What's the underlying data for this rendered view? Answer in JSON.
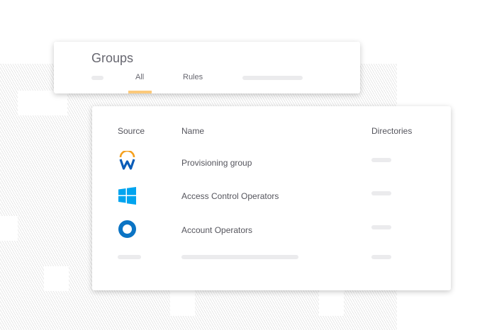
{
  "groups_card": {
    "title": "Groups",
    "tabs": [
      {
        "label": "All",
        "active": true
      },
      {
        "label": "Rules",
        "active": false
      }
    ]
  },
  "table": {
    "headers": {
      "source": "Source",
      "name": "Name",
      "directories": "Directories"
    },
    "rows": [
      {
        "source_icon": "workday-icon",
        "name": "Provisioning group"
      },
      {
        "source_icon": "windows-icon",
        "name": "Access Control Operators"
      },
      {
        "source_icon": "ring-directory-icon",
        "name": "Account Operators"
      }
    ]
  },
  "colors": {
    "accent": "#fbc97a",
    "workday_blue": "#0a5cb8",
    "workday_orange": "#f4a01e",
    "windows_blue": "#00a4ef",
    "ring_blue": "#0b74c4"
  }
}
